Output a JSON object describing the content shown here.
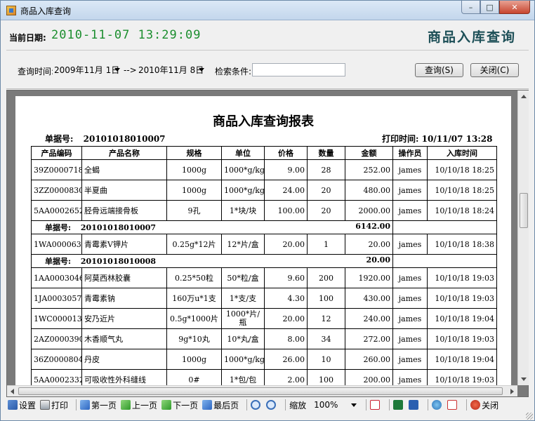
{
  "window": {
    "title": "商品入库查询"
  },
  "header": {
    "date_label": "当前日期:",
    "date_value": "2010-11-07 13:29:09",
    "big_title": "商品入库查询"
  },
  "query": {
    "time_label": "查询时间:",
    "date_from": "2009年11月 1日",
    "arrow_text": "-->",
    "date_to": "2010年11月 8日",
    "condition_label": "检索条件:",
    "condition_value": "",
    "search_button": "查询(S)",
    "close_button": "关闭(C)"
  },
  "report": {
    "title": "商品入库查询报表",
    "doc_no_label": "单据号:",
    "doc_no": "20101018010007",
    "print_time_label": "打印时间:",
    "print_time": "10/11/07 13:28",
    "columns": [
      "产品编码",
      "产品名称",
      "规格",
      "单位",
      "价格",
      "数量",
      "金额",
      "操作员",
      "入库时间"
    ],
    "rows": [
      {
        "type": "item",
        "code": "39Z0000718",
        "name": "全蝎",
        "spec": "1000g",
        "unit": "1000*g/kg",
        "price": "9.00",
        "qty": "28",
        "amount": "252.00",
        "operator": "james",
        "time": "10/10/18 18:25"
      },
      {
        "type": "item",
        "code": "3ZZ0000830",
        "name": "半夏曲",
        "spec": "1000g",
        "unit": "1000*g/kg",
        "price": "24.00",
        "qty": "20",
        "amount": "480.00",
        "operator": "james",
        "time": "10/10/18 18:25"
      },
      {
        "type": "item",
        "code": "5AA0002652",
        "name": "胫骨远端接骨板",
        "spec": "9孔",
        "unit": "1*块/块",
        "price": "100.00",
        "qty": "20",
        "amount": "2000.00",
        "operator": "james",
        "time": "10/10/18 18:24"
      },
      {
        "type": "subtotal",
        "label": "单据号:",
        "doc_no": "20101018010007",
        "total": "6142.00"
      },
      {
        "type": "item",
        "code": "1WA0000634",
        "name": "青霉素V钾片",
        "spec": "0.25g*12片",
        "unit": "12*片/盒",
        "price": "20.00",
        "qty": "1",
        "amount": "20.00",
        "operator": "james",
        "time": "10/10/18 18:38"
      },
      {
        "type": "subtotal",
        "label": "单据号:",
        "doc_no": "20101018010008",
        "total": "20.00"
      },
      {
        "type": "item",
        "code": "1AA0003046",
        "name": "阿莫西林胶囊",
        "spec": "0.25*50粒",
        "unit": "50*粒/盒",
        "price": "9.60",
        "qty": "200",
        "amount": "1920.00",
        "operator": "james",
        "time": "10/10/18 19:03"
      },
      {
        "type": "item",
        "code": "1JA0003057",
        "name": "青霉素钠",
        "spec": "160万u*1支",
        "unit": "1*支/支",
        "price": "4.30",
        "qty": "100",
        "amount": "430.00",
        "operator": "james",
        "time": "10/10/18 19:03"
      },
      {
        "type": "item",
        "code": "1WC0000132",
        "name": "安乃近片",
        "spec": "0.5g*1000片",
        "unit": "1000*片/瓶",
        "price": "20.00",
        "qty": "12",
        "amount": "240.00",
        "operator": "james",
        "time": "10/10/18 19:04"
      },
      {
        "type": "item",
        "code": "2AZ0000390",
        "name": "木香顺气丸",
        "spec": "9g*10丸",
        "unit": "10*丸/盒",
        "price": "8.00",
        "qty": "34",
        "amount": "272.00",
        "operator": "james",
        "time": "10/10/18 19:03"
      },
      {
        "type": "item",
        "code": "36Z0000804",
        "name": "丹皮",
        "spec": "1000g",
        "unit": "1000*g/kg",
        "price": "26.00",
        "qty": "10",
        "amount": "260.00",
        "operator": "james",
        "time": "10/10/18 19:04"
      },
      {
        "type": "item",
        "code": "5AA0002332",
        "name": "可吸收性外科缝线",
        "spec": "0#",
        "unit": "1*包/包",
        "price": "2.00",
        "qty": "100",
        "amount": "200.00",
        "operator": "james",
        "time": "10/10/18 19:03"
      }
    ]
  },
  "toolbar": {
    "settings": "设置",
    "print": "打印",
    "first_page": "第一页",
    "prev_page": "上一页",
    "next_page": "下一页",
    "last_page": "最后页",
    "zoom_label": "缩放",
    "zoom_value": "100%",
    "close": "关闭"
  },
  "colors": {
    "date_green": "#1b8e2e",
    "title_teal": "#1d4f57",
    "viewer_gray": "#7a7a7a"
  }
}
